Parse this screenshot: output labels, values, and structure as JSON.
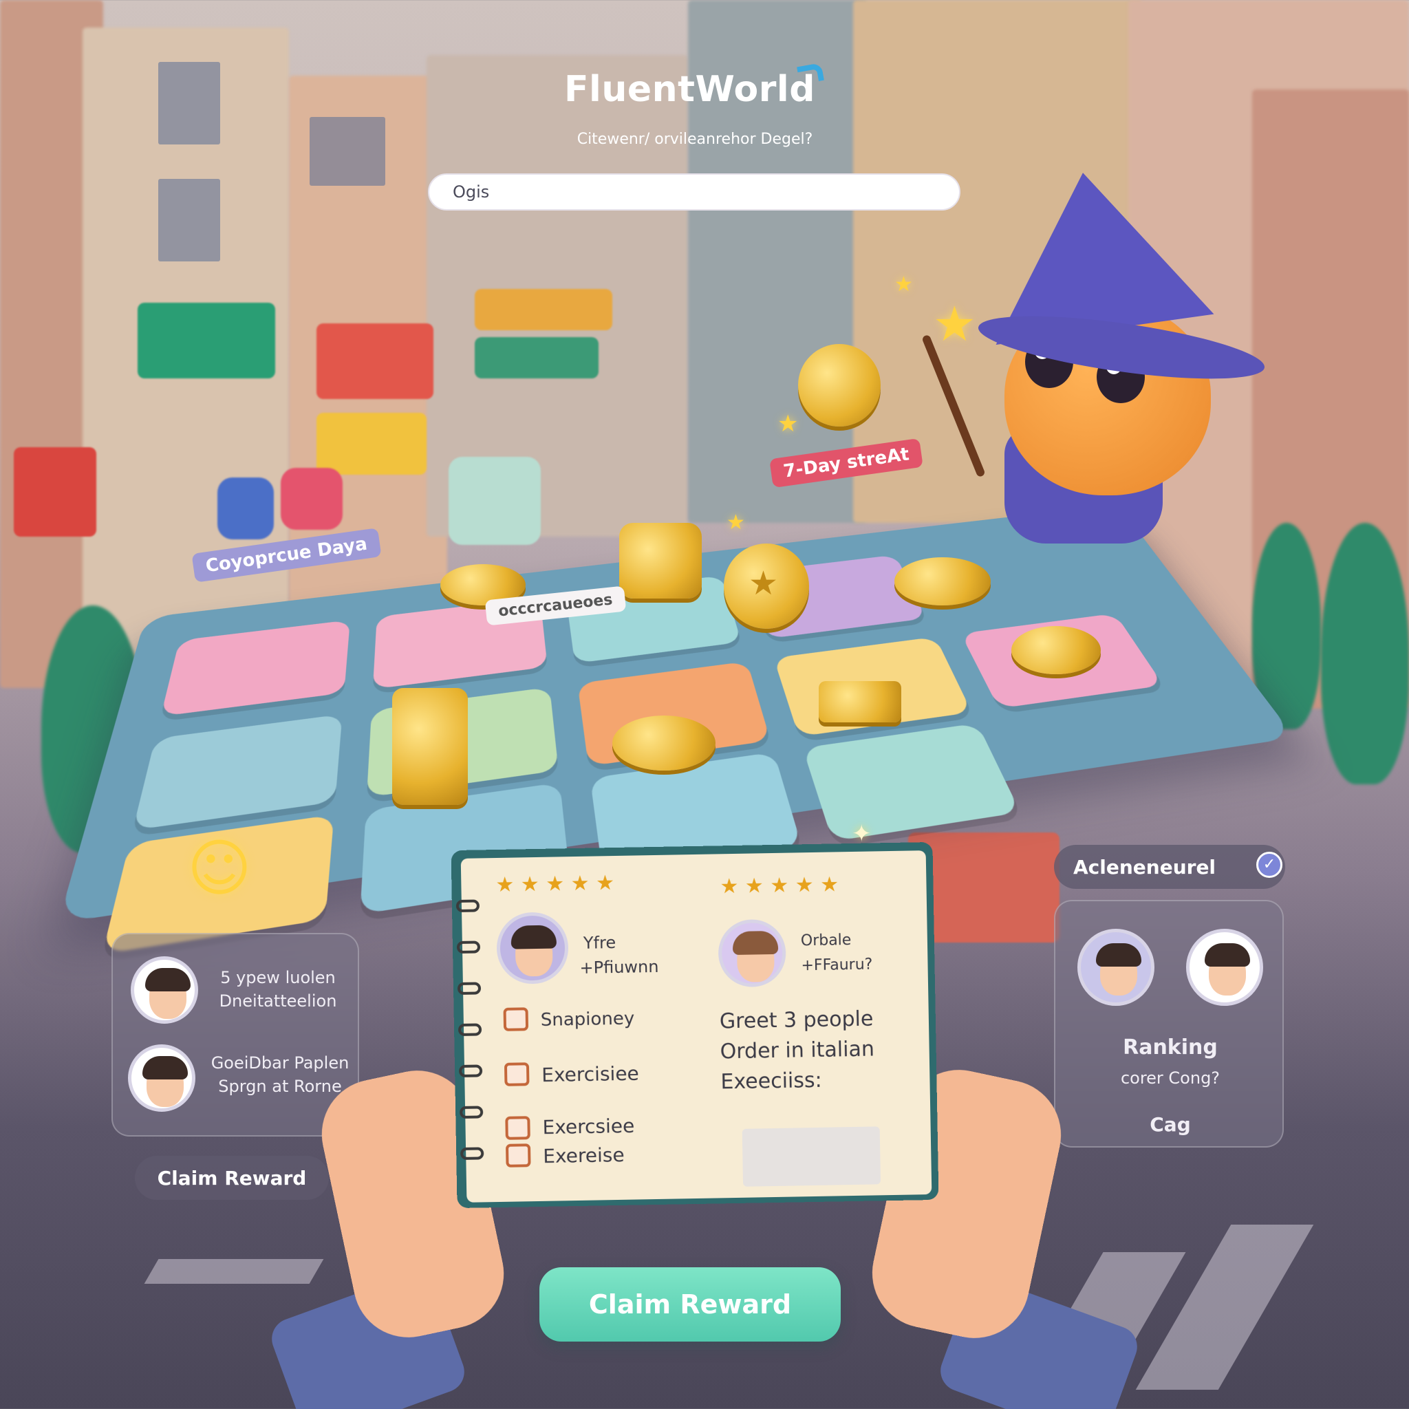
{
  "app": {
    "logo": "FluentWorld",
    "subtitle": "Citewenr/ orvileanrehor Degel?",
    "search_value": "Ogis"
  },
  "board": {
    "labels": {
      "streak": "7-Day streAt",
      "corporate": "Coyoprcue Daya",
      "plaque": "occcrcaueoes"
    }
  },
  "left_panel": {
    "entries": [
      {
        "line1": "5 ypew luolen",
        "line2": "Dneitatteelion"
      },
      {
        "line1": "GoeiDbar Paplen",
        "line2": "Sprgn at Rorne"
      }
    ],
    "claim_label": "Claim Reward"
  },
  "notebook": {
    "left_page": {
      "profile_line1": "Yfre",
      "profile_line2": "+Pfiuwnn",
      "tasks": [
        "Snapioney",
        "Exercisiee",
        "Exercsiee",
        "Exereise"
      ]
    },
    "right_page": {
      "profile_line1": "Orbale",
      "profile_line2": "+FFauru?",
      "goals": [
        "Greet 3 people",
        "Order in italian",
        "Exeeciiss:"
      ]
    }
  },
  "right_panel": {
    "achievement_label": "Acleneneurel",
    "ranking_title": "Ranking",
    "ranking_sub": "corer Cong?",
    "ranking_footer": "Cag"
  },
  "cta": {
    "claim_label": "Claim Reward"
  },
  "colors": {
    "accent_teal": "#52c9ad",
    "mascot_purple": "#5a54b8",
    "mascot_orange": "#e9862a",
    "coin_gold": "#e7b22e",
    "streak_red": "#e2546a"
  }
}
